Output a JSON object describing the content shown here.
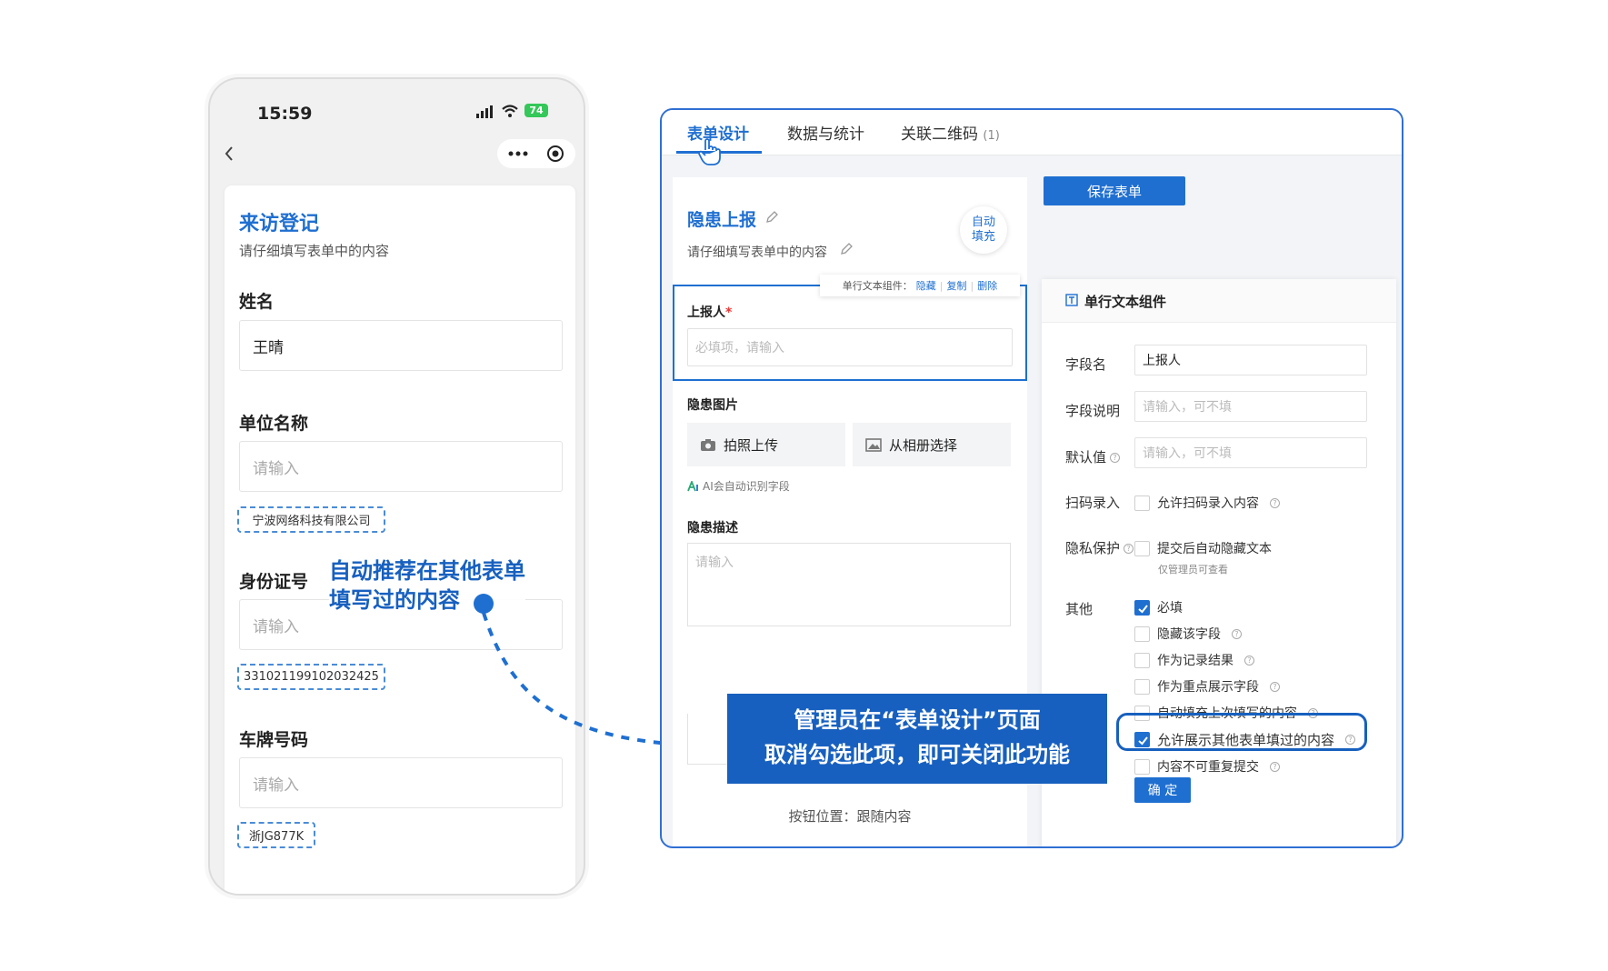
{
  "phone": {
    "time": "15:59",
    "battery": "74",
    "form_title": "来访登记",
    "form_subtitle": "请仔细填写表单中的内容",
    "fields": [
      {
        "label": "姓名",
        "value": "王晴",
        "suggestion": ""
      },
      {
        "label": "单位名称",
        "placeholder": "请输入",
        "suggestion": "宁波网络科技有限公司"
      },
      {
        "label": "身份证号",
        "placeholder": "请输入",
        "suggestion": "331021199102032425"
      },
      {
        "label": "车牌号码",
        "placeholder": "请输入",
        "suggestion": "浙JG877K"
      }
    ]
  },
  "annotation_phone": [
    "自动推荐在其他表单",
    "填写过的内容"
  ],
  "designer": {
    "tabs": [
      {
        "label": "表单设计",
        "active": true
      },
      {
        "label": "数据与统计"
      },
      {
        "label": "关联二维码",
        "count": "(1)"
      }
    ],
    "save_button": "保存表单",
    "form_title": "隐患上报",
    "form_subtitle": "请仔细填写表单中的内容",
    "auto_fill_badge": [
      "自动",
      "填充"
    ],
    "toolbar": {
      "label": "单行文本组件：",
      "hide": "隐藏",
      "copy": "复制",
      "delete": "删除"
    },
    "fields": {
      "reporter_label": "上报人",
      "required_mark": "*",
      "reporter_placeholder": "必填项，请输入",
      "image_label": "隐患图片",
      "photo_button": "拍照上传",
      "album_button": "从相册选择",
      "ai_hint": "AI会自动识别字段",
      "desc_label": "隐患描述",
      "desc_placeholder": "请输入"
    },
    "button_position": "按钮位置：跟随内容"
  },
  "props": {
    "title": "单行文本组件",
    "field_name_label": "字段名",
    "field_name_value": "上报人",
    "field_desc_label": "字段说明",
    "field_desc_placeholder": "请输入，可不填",
    "default_label": "默认值",
    "default_placeholder": "请输入，可不填",
    "scan_label": "扫码录入",
    "scan_option": "允许扫码录入内容",
    "privacy_label": "隐私保护",
    "privacy_option": "提交后自动隐藏文本",
    "privacy_note": "仅管理员可查看",
    "other_label": "其他",
    "options": [
      {
        "label": "必填",
        "checked": true,
        "help": false
      },
      {
        "label": "隐藏该字段",
        "checked": false,
        "help": true
      },
      {
        "label": "作为记录结果",
        "checked": false,
        "help": true
      },
      {
        "label": "作为重点展示字段",
        "checked": false,
        "help": true
      },
      {
        "label": "自动填充上次填写的内容",
        "checked": false,
        "help": true
      },
      {
        "label": "允许展示其他表单填过的内容",
        "checked": true,
        "help": true
      },
      {
        "label": "内容不可重复提交",
        "checked": false,
        "help": true
      }
    ],
    "confirm": "确 定"
  },
  "callout": [
    "管理员在“表单设计”页面",
    "取消勾选此项，即可关闭此功能"
  ],
  "colors": {
    "accent": "#1f6fd1",
    "dark_blue": "#1760bf",
    "frame": "#2f6fd3"
  },
  "icons": [
    "back-arrow-icon",
    "more-icon",
    "record-icon",
    "signal-icon",
    "wifi-icon",
    "battery-icon",
    "edit-icon",
    "camera-icon",
    "image-icon",
    "ai-icon",
    "text-component-icon",
    "help-icon",
    "pointer-hand-icon"
  ]
}
